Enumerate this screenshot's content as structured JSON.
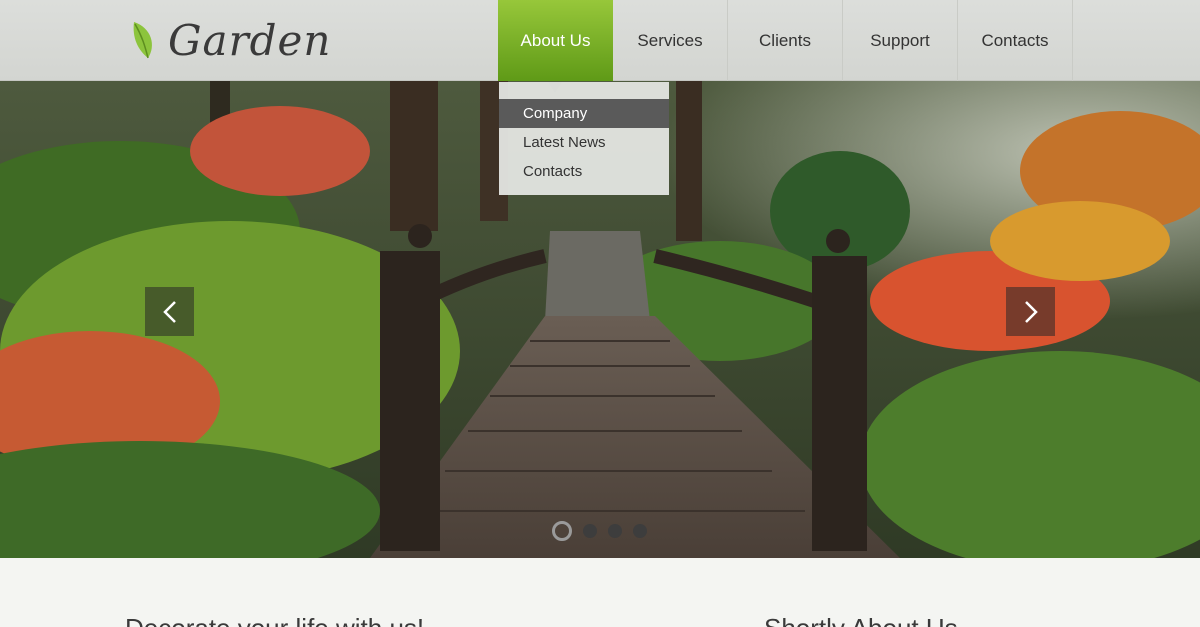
{
  "brand": {
    "name": "Garden",
    "icon": "leaf-icon"
  },
  "nav": {
    "items": [
      {
        "label": "About Us",
        "active": true
      },
      {
        "label": "Services"
      },
      {
        "label": "Clients"
      },
      {
        "label": "Support"
      },
      {
        "label": "Contacts"
      }
    ],
    "dropdown": [
      {
        "label": "Company",
        "active": true
      },
      {
        "label": "Latest News"
      },
      {
        "label": "Contacts"
      }
    ]
  },
  "slider": {
    "prev_icon": "chevron-left-icon",
    "next_icon": "chevron-right-icon",
    "slide_count": 4,
    "active_index": 0
  },
  "sections": {
    "left_heading": "Decorate your life with us!",
    "right_heading": "Shortly About Us"
  },
  "colors": {
    "accent": "#7db52a",
    "header_bg": "#d8dad6"
  }
}
